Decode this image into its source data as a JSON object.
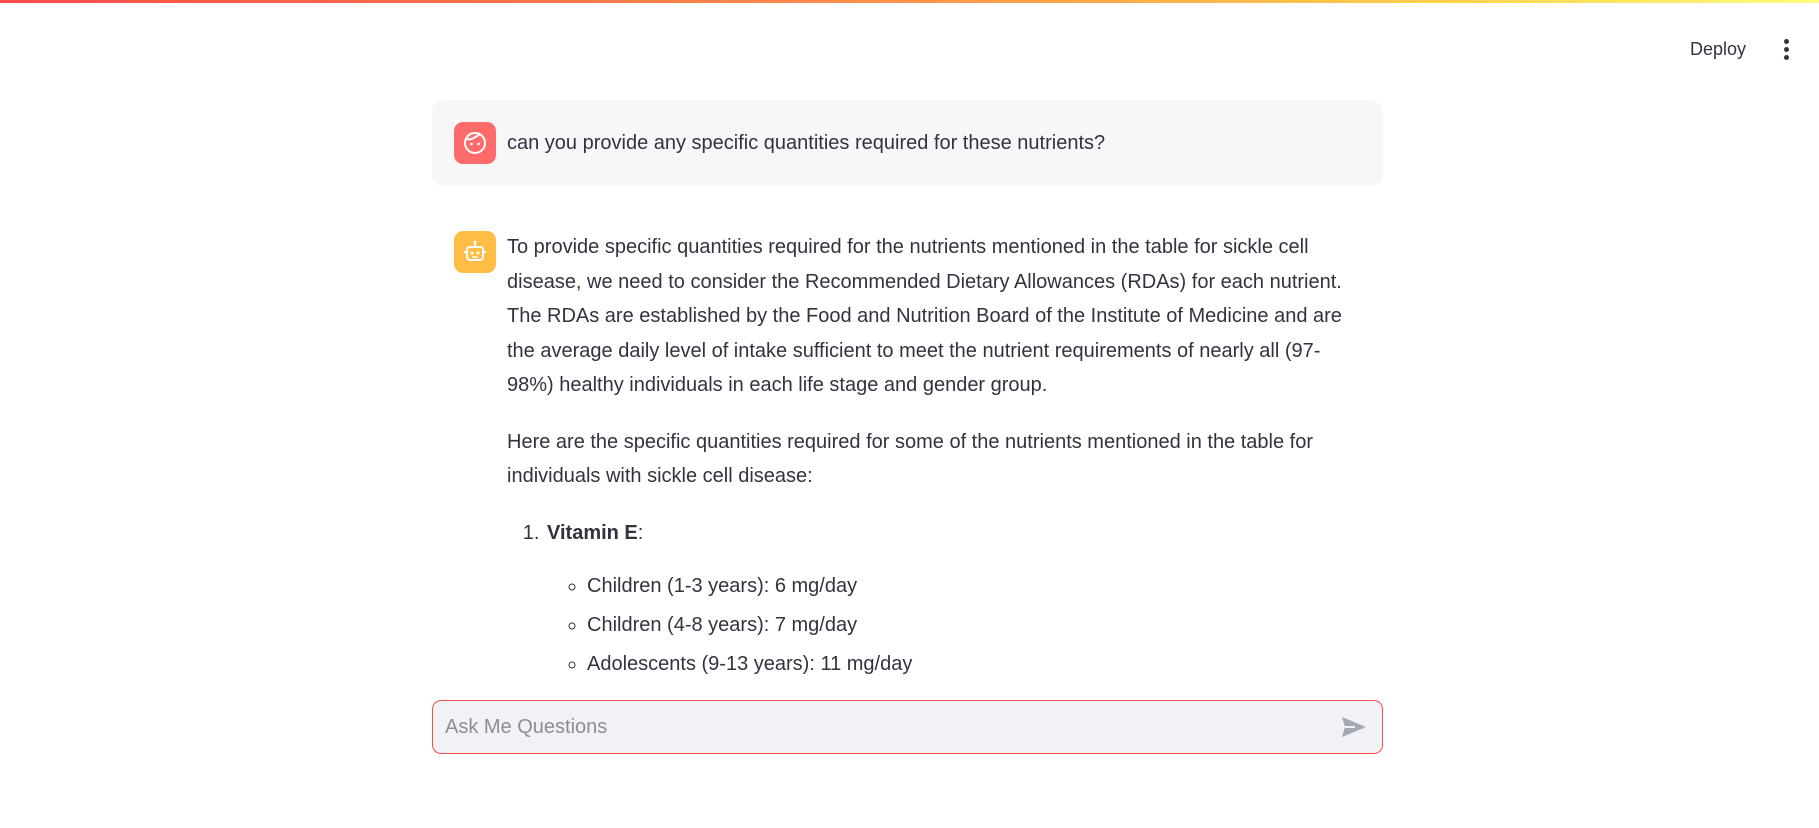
{
  "header": {
    "deploy_label": "Deploy",
    "menu_icon": "vertical-ellipsis-icon"
  },
  "colors": {
    "accent": "#ff4b4b",
    "user_avatar": "#ff6b6b",
    "assistant_avatar": "#ffbd45",
    "user_bubble_bg": "#f6f7f9",
    "input_bg": "#f0f2f6"
  },
  "messages": {
    "user": {
      "avatar_icon": "user-face-icon",
      "text": "can you provide any specific quantities required for these nutrients?"
    },
    "assistant": {
      "avatar_icon": "robot-icon",
      "paragraphs": [
        "To provide specific quantities required for the nutrients mentioned in the table for sickle cell disease, we need to consider the Recommended Dietary Allowances (RDAs) for each nutrient. The RDAs are established by the Food and Nutrition Board of the Institute of Medicine and are the average daily level of intake sufficient to meet the nutrient requirements of nearly all (97-98%) healthy individuals in each life stage and gender group.",
        "Here are the specific quantities required for some of the nutrients mentioned in the table for individuals with sickle cell disease:"
      ],
      "list": [
        {
          "name": "Vitamin E",
          "suffix": ":",
          "items": [
            "Children (1-3 years): 6 mg/day",
            "Children (4-8 years): 7 mg/day",
            "Adolescents (9-13 years): 11 mg/day"
          ]
        }
      ]
    }
  },
  "chat_input": {
    "placeholder": "Ask Me Questions",
    "value": "",
    "send_icon": "send-icon"
  }
}
